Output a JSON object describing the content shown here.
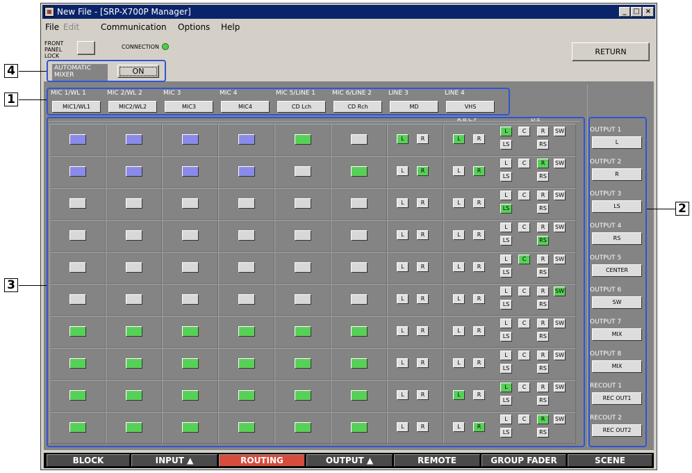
{
  "window": {
    "title": "New File - [SRP-X700P Manager]",
    "buttons": {
      "minimize": "_",
      "maximize": "□",
      "close": "×"
    }
  },
  "menu": [
    "File",
    "Edit",
    "Communication",
    "Options",
    "Help"
  ],
  "controls": {
    "front_panel_lock": "FRONT PANEL LOCK",
    "connection": "CONNECTION",
    "return": "RETURN",
    "automatic_mixer": "AUTOMATIC MIXER",
    "automatic_mixer_state": "ON"
  },
  "callouts": [
    "4",
    "1",
    "2",
    "3"
  ],
  "inputs": [
    {
      "header": "MIC 1/WL 1",
      "button": "MIC1/WL1"
    },
    {
      "header": "MIC 2/WL 2",
      "button": "MIC2/WL2"
    },
    {
      "header": "MIC 3",
      "button": "MIC3"
    },
    {
      "header": "MIC 4",
      "button": "MIC4"
    },
    {
      "header": "MIC 5/LINE 1",
      "button": "CD Lch"
    },
    {
      "header": "MIC 6/LINE 2",
      "button": "CD Rch"
    },
    {
      "header": "LINE 3",
      "button": "MD"
    },
    {
      "header": "LINE 4",
      "button": "VHS"
    }
  ],
  "group_labels": {
    "abcf": "A,B,C,F",
    "de": "D,E"
  },
  "outputs": [
    {
      "label": "OUTPUT 1",
      "button": "L"
    },
    {
      "label": "OUTPUT 2",
      "button": "R"
    },
    {
      "label": "OUTPUT 3",
      "button": "LS"
    },
    {
      "label": "OUTPUT 4",
      "button": "RS"
    },
    {
      "label": "OUTPUT 5",
      "button": "CENTER"
    },
    {
      "label": "OUTPUT 6",
      "button": "SW"
    },
    {
      "label": "OUTPUT 7",
      "button": "MIX"
    },
    {
      "label": "OUTPUT 8",
      "button": "MIX"
    },
    {
      "label": "RECOUT 1",
      "button": "REC OUT1"
    },
    {
      "label": "RECOUT 2",
      "button": "REC OUT2"
    }
  ],
  "routing_rows": [
    {
      "cols": [
        "blue",
        "blue",
        "blue",
        "blue",
        "green",
        "grey"
      ],
      "line3": "L",
      "line4": "L",
      "de": "L"
    },
    {
      "cols": [
        "blue",
        "blue",
        "blue",
        "blue",
        "grey",
        "green"
      ],
      "line3": "R",
      "line4": "R",
      "de": "R"
    },
    {
      "cols": [
        "grey",
        "grey",
        "grey",
        "grey",
        "grey",
        "grey"
      ],
      "line3": "",
      "line4": "",
      "de": "LS"
    },
    {
      "cols": [
        "grey",
        "grey",
        "grey",
        "grey",
        "grey",
        "grey"
      ],
      "line3": "",
      "line4": "",
      "de": "RS"
    },
    {
      "cols": [
        "grey",
        "grey",
        "grey",
        "grey",
        "grey",
        "grey"
      ],
      "line3": "",
      "line4": "",
      "de": "C"
    },
    {
      "cols": [
        "grey",
        "grey",
        "grey",
        "grey",
        "grey",
        "grey"
      ],
      "line3": "",
      "line4": "",
      "de": "SW"
    },
    {
      "cols": [
        "green",
        "green",
        "green",
        "green",
        "green",
        "green"
      ],
      "line3": "",
      "line4": "",
      "de": ""
    },
    {
      "cols": [
        "green",
        "green",
        "green",
        "green",
        "green",
        "green"
      ],
      "line3": "",
      "line4": "",
      "de": ""
    },
    {
      "cols": [
        "green",
        "green",
        "green",
        "green",
        "green",
        "green"
      ],
      "line3": "",
      "line4": "L",
      "de": "L"
    },
    {
      "cols": [
        "green",
        "green",
        "green",
        "green",
        "green",
        "green"
      ],
      "line3": "",
      "line4": "R",
      "de": "R"
    }
  ],
  "button_labels": {
    "L": "L",
    "R": "R",
    "C": "C",
    "SW": "SW",
    "LS": "LS",
    "RS": "RS"
  },
  "tabs": [
    {
      "label": "BLOCK",
      "active": false
    },
    {
      "label": "INPUT ▲",
      "active": false
    },
    {
      "label": "ROUTING",
      "active": true
    },
    {
      "label": "OUTPUT ▲",
      "active": false
    },
    {
      "label": "REMOTE",
      "active": false
    },
    {
      "label": "GROUP FADER",
      "active": false
    },
    {
      "label": "SCENE",
      "active": false
    }
  ],
  "colors": {
    "selected_blue": "#8a8ae8",
    "selected_green": "#58d058",
    "off": "#d8d8d8",
    "active_tab": "#d84c3c",
    "frame": "#2f55d4",
    "titlebar": "#0a246a"
  }
}
